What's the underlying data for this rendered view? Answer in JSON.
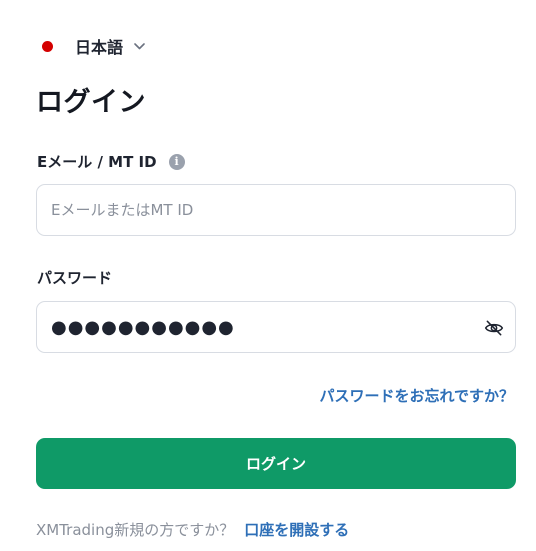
{
  "language_selector": {
    "label": "日本語",
    "flag_icon": "japan-flag-dot",
    "chevron_icon": "chevron-down-icon"
  },
  "page": {
    "title": "ログイン"
  },
  "email_field": {
    "label": "Eメール / MT ID",
    "info_icon": "info-icon",
    "info_glyph": "i",
    "placeholder": "EメールまたはMT ID",
    "value": ""
  },
  "password_field": {
    "label": "パスワード",
    "value": "●●●●●●●●●●●",
    "toggle_icon": "eye-off-icon"
  },
  "links": {
    "forgot_password": "パスワードをお忘れですか？"
  },
  "buttons": {
    "login_label": "ログイン"
  },
  "signup": {
    "prompt": "XMTrading新規の方ですか？",
    "link_label": "口座を開設する"
  },
  "colors": {
    "primary_button": "#0f9a67",
    "link": "#2e6fb7",
    "flag_red": "#d40000",
    "muted_text": "#8a909b"
  }
}
